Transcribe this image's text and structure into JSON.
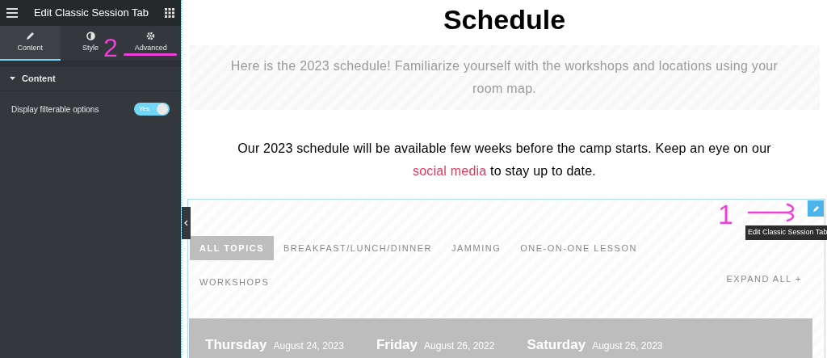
{
  "panel": {
    "title": "Edit Classic Session Tab",
    "tabs": [
      {
        "label": "Content",
        "selected": true
      },
      {
        "label": "Style",
        "selected": false
      },
      {
        "label": "Advanced",
        "selected": false
      }
    ],
    "section": {
      "title": "Content",
      "expanded": true
    },
    "controls": [
      {
        "label": "Display filterable options",
        "on": true,
        "switch_text": "Yes"
      }
    ]
  },
  "page": {
    "heading": "Schedule",
    "intro": "Here is the 2023 schedule! Familiarize yourself with the workshops and locations using your room map.",
    "notice": "Our 2023 schedule will be available few weeks before the camp starts. Keep an eye on our",
    "notice_link": "social media",
    "notice_end": "to stay up to date.",
    "tooltip": "Edit Classic Session Tab",
    "filters": [
      {
        "label": "ALL TOPICS",
        "selected": true
      },
      {
        "label": "BREAKFAST/LUNCH/DINNER",
        "selected": false
      },
      {
        "label": "JAMMING",
        "selected": false
      },
      {
        "label": "ONE-ON-ONE LESSON",
        "selected": false
      },
      {
        "label": "WORKSHOPS",
        "selected": false
      }
    ],
    "expand_all": "EXPAND ALL +",
    "days": [
      {
        "day": "Thursday",
        "date": "August 24, 2023"
      },
      {
        "day": "Friday",
        "date": "August 26, 2022"
      },
      {
        "day": "Saturday",
        "date": "August 26, 2023"
      }
    ]
  },
  "annotations": [
    "1",
    "2"
  ]
}
